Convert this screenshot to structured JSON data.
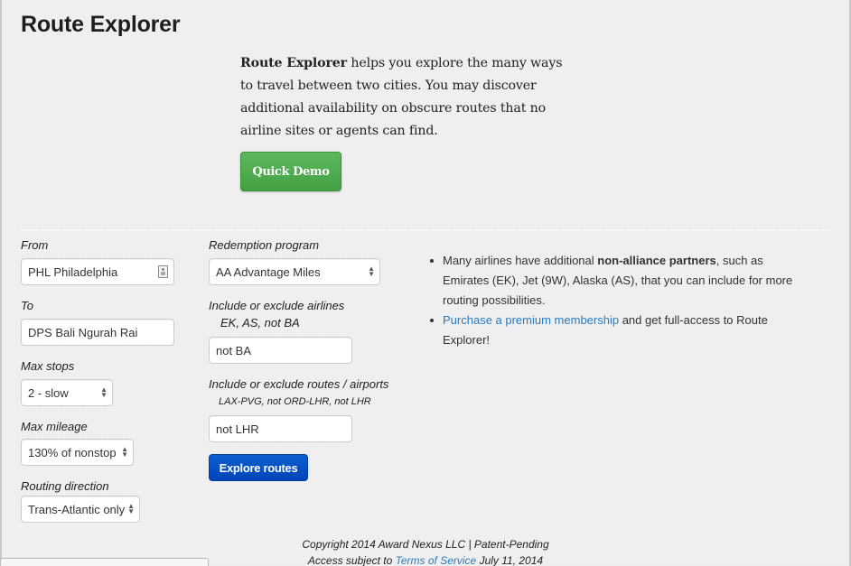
{
  "header": {
    "title": "Route Explorer"
  },
  "intro": {
    "bold": "Route Explorer",
    "text": " helps you explore the many ways to travel between two cities. You may discover additional availability on obscure routes that no airline sites or agents can find.",
    "quick_demo_label": "Quick Demo"
  },
  "form": {
    "from": {
      "label": "From",
      "value": "PHL Philadelphia",
      "icon": "contact-card-icon"
    },
    "to": {
      "label": "To",
      "value": "DPS Bali Ngurah Rai"
    },
    "max_stops": {
      "label": "Max stops",
      "value": "2 - slow"
    },
    "max_mileage": {
      "label": "Max mileage",
      "value": "130% of nonstop"
    },
    "routing_direction": {
      "label": "Routing direction",
      "value": "Trans-Atlantic only"
    },
    "redemption_program": {
      "label": "Redemption program",
      "value": "AA Advantage Miles"
    },
    "airlines": {
      "label": "Include or exclude airlines",
      "hint": "EK, AS, not BA",
      "value": "not BA"
    },
    "routes": {
      "label": "Include or exclude routes / airports",
      "hint": "LAX-PVG, not ORD-LHR, not LHR",
      "value": "not LHR"
    },
    "submit_label": "Explore routes"
  },
  "info": {
    "item1_pre": "Many airlines have additional ",
    "item1_bold": "non-alliance partners",
    "item1_post": ", such as Emirates (EK), Jet (9W), Alaska (AS), that you can include for more routing possibilities.",
    "item2_link": "Purchase a premium membership",
    "item2_post": " and get full-access to Route Explorer!"
  },
  "footer": {
    "copyright": "Copyright 2014 Award Nexus LLC | Patent-Pending",
    "access_pre": "Access subject to ",
    "tos_link": "Terms of Service",
    "access_post": " July 11, 2014"
  },
  "colors": {
    "quick_demo_green": "#4cae4c",
    "explore_blue": "#0a52c4",
    "link_blue": "#2a7bbf"
  }
}
